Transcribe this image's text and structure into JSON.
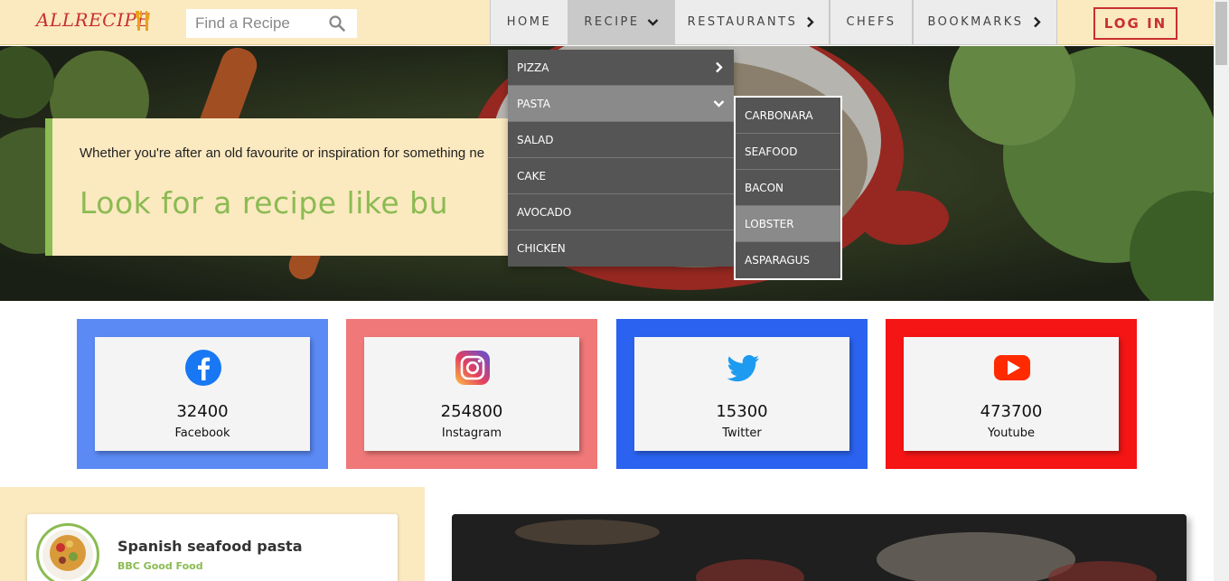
{
  "header": {
    "logo_text": "ALLRECIPE",
    "search": {
      "placeholder": "Find a Recipe",
      "value": ""
    },
    "nav": [
      {
        "label": "HOME",
        "has_arrow": false
      },
      {
        "label": "RECIPE",
        "has_arrow": true,
        "arrow": "chevron-down-icon",
        "active": true
      },
      {
        "label": "RESTAURANTS",
        "has_arrow": true,
        "arrow": "chevron-right-icon"
      },
      {
        "label": "CHEFS",
        "has_arrow": false
      },
      {
        "label": "BOOKMARKS",
        "has_arrow": true,
        "arrow": "chevron-right-icon"
      }
    ],
    "login_label": "LOG IN",
    "colors": {
      "header_bg": "#fbe9c0",
      "brand_red": "#c8302f",
      "accent_green": "#8bbb52"
    }
  },
  "hero": {
    "text": "Whether you're after an old favourite or inspiration for something ne",
    "title": "Look for a recipe like bu"
  },
  "recipe_menu": {
    "items": [
      {
        "label": "PIZZA",
        "icon": "chevron-right-icon"
      },
      {
        "label": "PASTA",
        "icon": "chevron-down-icon",
        "active": true
      },
      {
        "label": "SALAD"
      },
      {
        "label": "CAKE"
      },
      {
        "label": "AVOCADO"
      },
      {
        "label": "CHICKEN"
      }
    ],
    "pasta_submenu": [
      {
        "label": "CARBONARA"
      },
      {
        "label": "SEAFOOD"
      },
      {
        "label": "BACON"
      },
      {
        "label": "LOBSTER",
        "active": true
      },
      {
        "label": "ASPARAGUS"
      }
    ]
  },
  "social": [
    {
      "count": "32400",
      "label": "Facebook",
      "icon": "facebook-icon",
      "border_color": "#5b8af5"
    },
    {
      "count": "254800",
      "label": "Instagram",
      "icon": "instagram-icon",
      "border_color": "#f07878"
    },
    {
      "count": "15300",
      "label": "Twitter",
      "icon": "twitter-icon",
      "border_color": "#2b63f0"
    },
    {
      "count": "473700",
      "label": "Youtube",
      "icon": "youtube-icon",
      "border_color": "#f51515"
    }
  ],
  "featured_recipe": {
    "title": "Spanish seafood pasta",
    "source": "BBC Good Food"
  }
}
